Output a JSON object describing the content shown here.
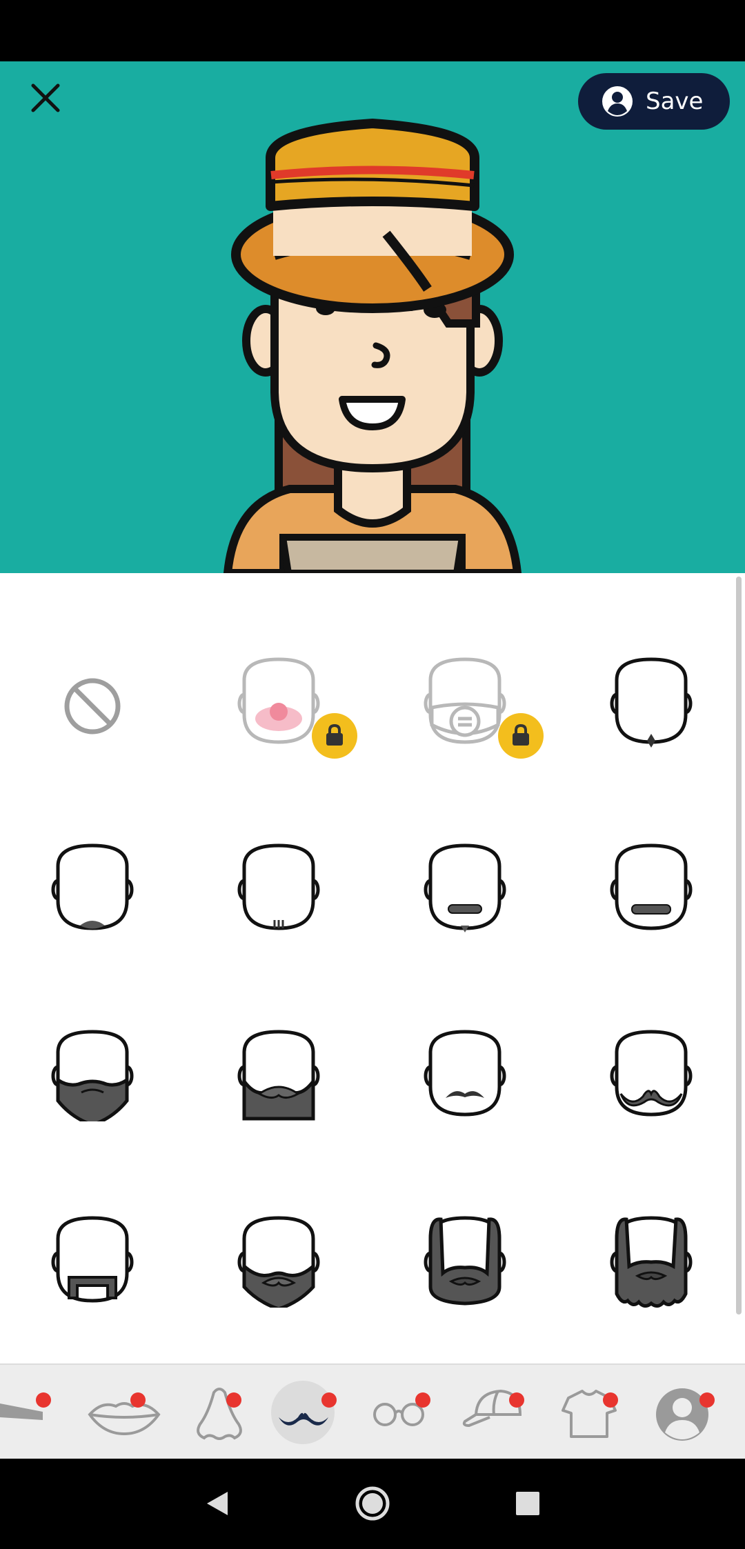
{
  "app": {
    "save_label": "Save",
    "colors": {
      "preview_bg": "#19ada1",
      "save_button_bg": "#0f1d3b",
      "lock_badge": "#f3be1d",
      "notification_dot": "#e8352f",
      "beard_fill": "#555555",
      "hat": "#e6a623",
      "skin": "#f8dfc2",
      "hair": "#8a5139"
    }
  },
  "toolbar": {
    "close_icon": "close-icon",
    "save_icon": "user-circle-icon"
  },
  "beard_options": [
    {
      "name": "none",
      "locked": false,
      "selected": false
    },
    {
      "name": "clown-nose",
      "locked": true,
      "selected": false
    },
    {
      "name": "face-mask",
      "locked": true,
      "selected": false
    },
    {
      "name": "chin-tuft",
      "locked": false,
      "selected": false
    },
    {
      "name": "chin-patch",
      "locked": false,
      "selected": false
    },
    {
      "name": "soul-patch",
      "locked": false,
      "selected": false
    },
    {
      "name": "mustache-goatee",
      "locked": false,
      "selected": false
    },
    {
      "name": "thin-mustache",
      "locked": false,
      "selected": false
    },
    {
      "name": "full-beard",
      "locked": false,
      "selected": false
    },
    {
      "name": "thick-beard-mustache",
      "locked": false,
      "selected": false
    },
    {
      "name": "pencil-mustache",
      "locked": false,
      "selected": false
    },
    {
      "name": "handlebar-mustache",
      "locked": false,
      "selected": false
    },
    {
      "name": "horseshoe-mustache",
      "locked": false,
      "selected": false
    },
    {
      "name": "short-beard",
      "locked": false,
      "selected": false
    },
    {
      "name": "long-beard-sideburns",
      "locked": false,
      "selected": false
    },
    {
      "name": "wavy-long-beard",
      "locked": false,
      "selected": false
    }
  ],
  "tabs": [
    {
      "icon": "eyebrows-icon",
      "has_dot": true,
      "selected": false
    },
    {
      "icon": "lips-icon",
      "has_dot": true,
      "selected": false
    },
    {
      "icon": "nose-icon",
      "has_dot": true,
      "selected": false
    },
    {
      "icon": "mustache-icon",
      "has_dot": true,
      "selected": true
    },
    {
      "icon": "glasses-icon",
      "has_dot": true,
      "selected": false
    },
    {
      "icon": "cap-icon",
      "has_dot": true,
      "selected": false
    },
    {
      "icon": "tshirt-icon",
      "has_dot": true,
      "selected": false
    },
    {
      "icon": "avatar-icon",
      "has_dot": true,
      "selected": false
    }
  ],
  "system_nav": [
    "back-icon",
    "home-icon",
    "recents-icon"
  ]
}
